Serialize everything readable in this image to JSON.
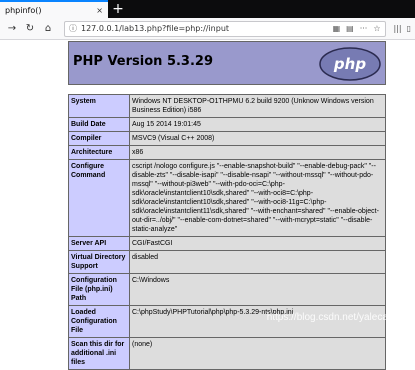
{
  "browser": {
    "tab_title": "phpinfo()",
    "tab_close": "×",
    "new_tab": "+",
    "url": "127.0.0.1/lab13.php?file=php://input",
    "info_icon": "ⓘ",
    "more": "···"
  },
  "page": {
    "title": "PHP Version 5.3.29",
    "logo_text": "php",
    "rows": [
      {
        "k": "System",
        "v": "Windows NT DESKTOP-O1THPMU 6.2 build 9200 (Unknow Windows version Business Edition) i586"
      },
      {
        "k": "Build Date",
        "v": "Aug 15 2014 19:01:45"
      },
      {
        "k": "Compiler",
        "v": "MSVC9 (Visual C++ 2008)"
      },
      {
        "k": "Architecture",
        "v": "x86"
      },
      {
        "k": "Configure Command",
        "v": "cscript /nologo configure.js \"--enable-snapshot-build\" \"--enable-debug-pack\" \"--disable-zts\" \"--disable-isapi\" \"--disable-nsapi\" \"--without-mssql\" \"--without-pdo-mssql\" \"--without-pi3web\" \"--with-pdo-oci=C:\\php-sdk\\oracle\\instantclient10\\sdk,shared\" \"--with-oci8=C:\\php-sdk\\oracle\\instantclient10\\sdk,shared\" \"--with-oci8-11g=C:\\php-sdk\\oracle\\instantclient11\\sdk,shared\" \"--with-enchant=shared\" \"--enable-object-out-dir=../obj/\" \"--enable-com-dotnet=shared\" \"--with-mcrypt=static\" \"--disable-static-analyze\""
      },
      {
        "k": "Server API",
        "v": "CGI/FastCGI"
      },
      {
        "k": "Virtual Directory Support",
        "v": "disabled"
      },
      {
        "k": "Configuration File (php.ini) Path",
        "v": "C:\\Windows"
      },
      {
        "k": "Loaded Configuration File",
        "v": "C:\\phpStudy\\PHPTutorial\\php\\php-5.3.29-nts\\php.ini"
      },
      {
        "k": "Scan this dir for additional .ini files",
        "v": "(none)"
      }
    ]
  },
  "watermark": "https://blog.csdn.net/yalecaltech"
}
